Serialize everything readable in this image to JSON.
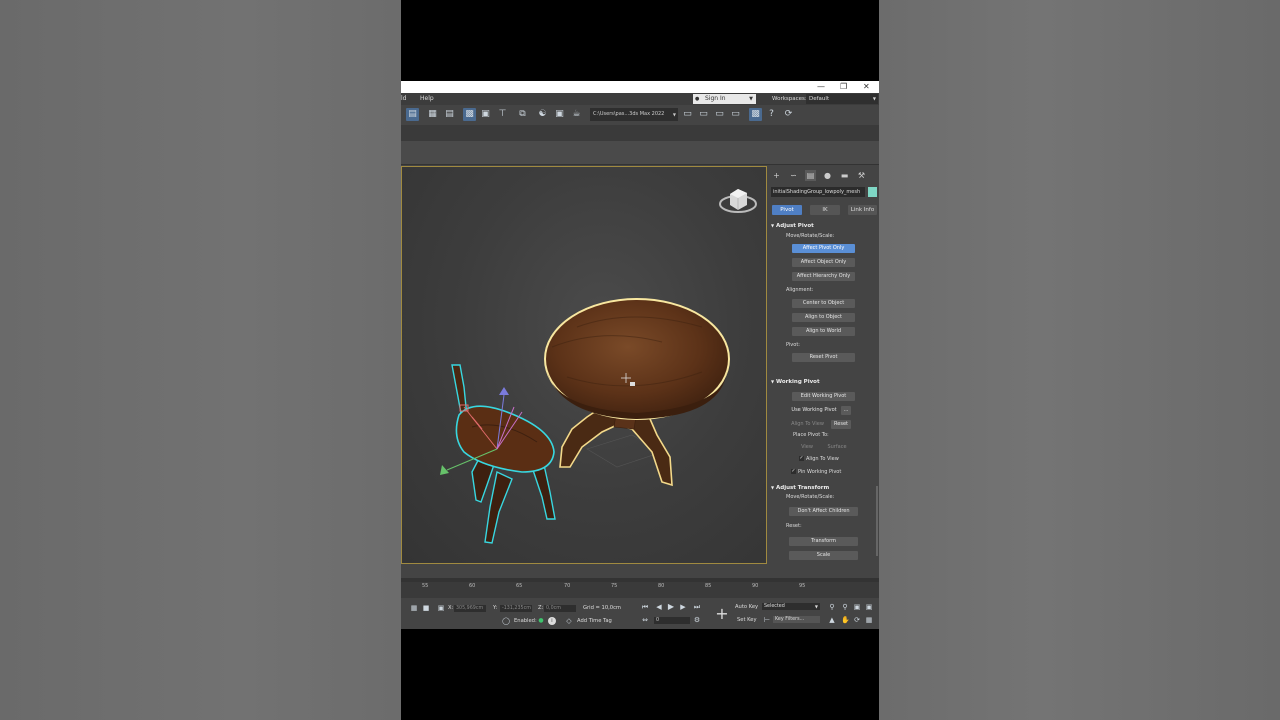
{
  "menubar": {
    "item_left": "ld",
    "item_help": "Help",
    "signin": "Sign In",
    "workspaces_label": "Workspaces:",
    "workspace_value": "Default"
  },
  "toolbar": {
    "path": "C:\\Users\\pas...3ds Max 2022"
  },
  "command_panel": {
    "object_name": "initialShadingGroup_lowpoly_mesh",
    "object_color": "#7fd7c5",
    "tabs": [
      "Pivot",
      "IK",
      "Link Info"
    ],
    "adjust_pivot": {
      "title": "Adjust Pivot",
      "move_rotate_scale_label": "Move/Rotate/Scale:",
      "affect_pivot_only": "Affect Pivot Only",
      "affect_object_only": "Affect Object Only",
      "affect_hierarchy_only": "Affect Hierarchy Only",
      "alignment_label": "Alignment:",
      "center_to_object": "Center to Object",
      "align_to_object": "Align to Object",
      "align_to_world": "Align to World",
      "pivot_label": "Pivot:",
      "reset_pivot": "Reset Pivot"
    },
    "working_pivot": {
      "title": "Working Pivot",
      "edit_working_pivot": "Edit Working Pivot",
      "use_working_pivot": "Use Working Pivot",
      "more": "...",
      "align_to_view_btn": "Align To View",
      "reset": "Reset",
      "place_pivot_to_label": "Place Pivot To:",
      "view": "View",
      "surface": "Surface",
      "align_to_view_check": "Align To View",
      "pin_working_pivot": "Pin Working Pivot"
    },
    "adjust_transform": {
      "title": "Adjust Transform",
      "move_rotate_scale_label": "Move/Rotate/Scale:",
      "dont_affect_children": "Don't Affect Children",
      "reset_label": "Reset:",
      "transform": "Transform",
      "scale": "Scale"
    }
  },
  "timeline": {
    "ticks": [
      "55",
      "60",
      "65",
      "70",
      "75",
      "80",
      "85",
      "90",
      "95"
    ]
  },
  "status": {
    "x_label": "X:",
    "x_value": "305,969cm",
    "y_label": "Y:",
    "y_value": "-131,235cm",
    "z_label": "Z:",
    "z_value": "0,0cm",
    "grid": "Grid = 10,0cm",
    "enabled_label": "Enabled:",
    "add_time_tag": "Add Time Tag",
    "frame": "0",
    "auto_key": "Auto Key",
    "selected": "Selected",
    "set_key": "Set Key",
    "key_filters": "Key Filters..."
  }
}
